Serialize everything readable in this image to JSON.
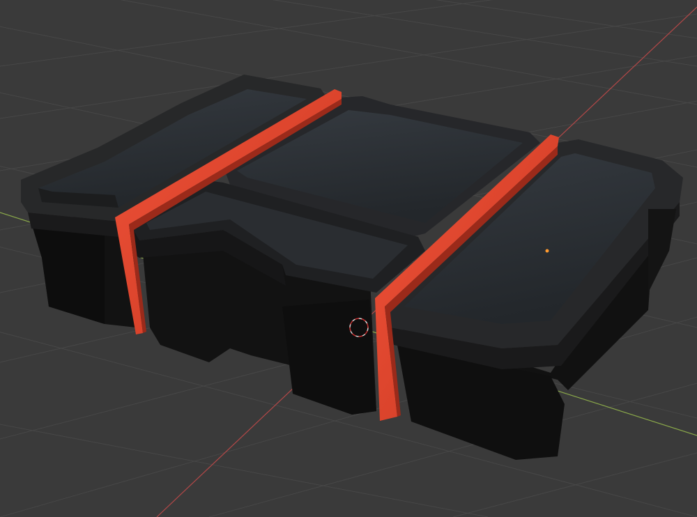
{
  "viewport": {
    "background_color": "#3a3a3a",
    "grid_color": "#474747",
    "x_axis_color": "#b54848",
    "y_axis_color": "#8aa84a",
    "origin_point_color": "#ff9a2e"
  },
  "model": {
    "body_color": "#121212",
    "body_shade_color": "#0b0b0b",
    "rim_color": "#272829",
    "tray_floor_color": "#2a2e33",
    "latch_color": "#e2452b",
    "latch_dark_color": "#9b2a1a"
  },
  "cursor": {
    "icon": "3d-cursor-icon"
  }
}
